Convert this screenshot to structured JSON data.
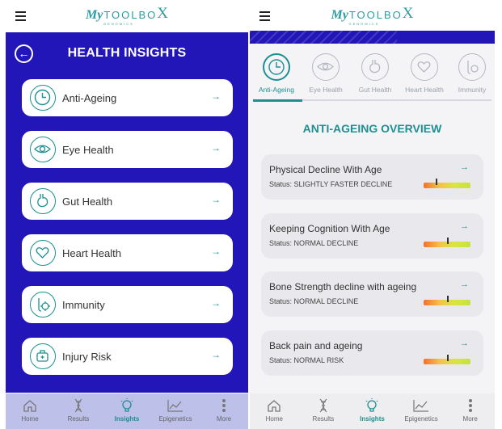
{
  "colors": {
    "accent": "#1d8f92",
    "primary": "#2216b8",
    "nav_left_bg": "#bdc0e9"
  },
  "app": {
    "logo_my": "My",
    "logo_toolbox": "TOOLBO",
    "logo_x": "X",
    "logo_sub": "GENOMICS"
  },
  "left": {
    "title": "HEALTH INSIGHTS",
    "back_icon": "back-arrow-icon",
    "items": [
      {
        "label": "Anti-Ageing",
        "icon": "clock-icon"
      },
      {
        "label": "Eye Health",
        "icon": "eye-icon"
      },
      {
        "label": "Gut Health",
        "icon": "stomach-icon"
      },
      {
        "label": "Heart Health",
        "icon": "heart-icon"
      },
      {
        "label": "Immunity",
        "icon": "immunity-icon"
      },
      {
        "label": "Injury Risk",
        "icon": "injury-icon"
      }
    ],
    "arrow": "→"
  },
  "right": {
    "tabs": [
      {
        "label": "Anti-Ageing",
        "active": true
      },
      {
        "label": "Eye Health"
      },
      {
        "label": "Gut Health"
      },
      {
        "label": "Heart Health"
      },
      {
        "label": "Immunity"
      }
    ],
    "overview_title": "ANTI-AGEING OVERVIEW",
    "cards": [
      {
        "title": "Physical Decline With Age",
        "status": "Status: SLIGHTLY FASTER DECLINE",
        "level": 0.25
      },
      {
        "title": "Keeping Cognition With Age",
        "status": "Status: NORMAL DECLINE",
        "level": 0.5
      },
      {
        "title": "Bone Strength decline with ageing",
        "status": "Status: NORMAL DECLINE",
        "level": 0.5
      },
      {
        "title": "Back pain and ageing",
        "status": "Status: NORMAL RISK",
        "level": 0.5
      }
    ],
    "arrow": "→"
  },
  "nav": {
    "items": [
      {
        "label": "Home",
        "icon": "home-icon"
      },
      {
        "label": "Results",
        "icon": "dna-icon"
      },
      {
        "label": "Insights",
        "icon": "lightbulb-icon",
        "active": true
      },
      {
        "label": "Epigenetics",
        "icon": "chart-icon"
      },
      {
        "label": "More",
        "icon": "more-dots-icon"
      }
    ]
  }
}
